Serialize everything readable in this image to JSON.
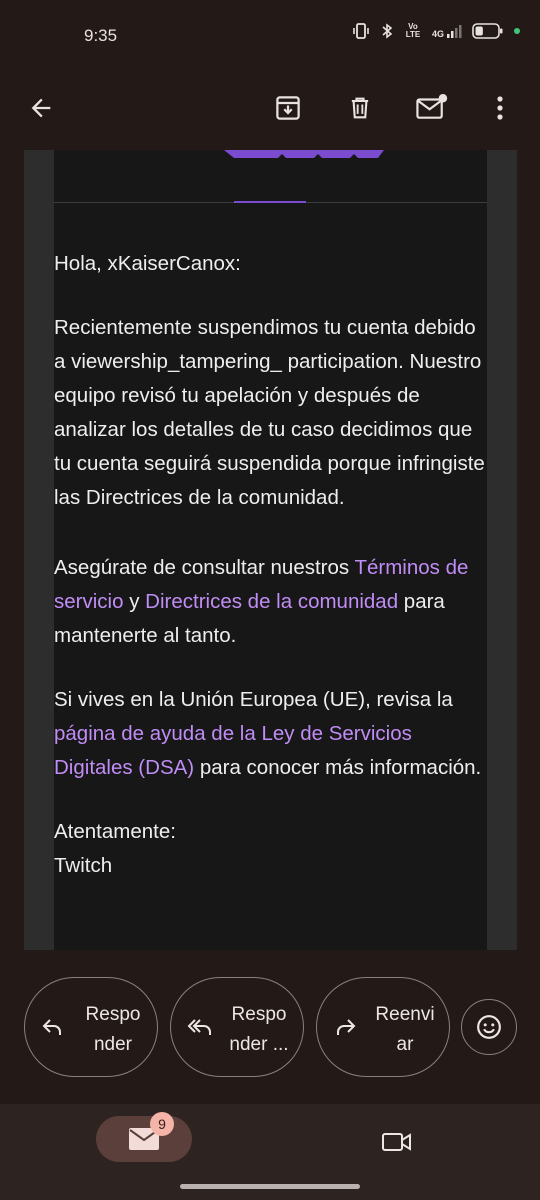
{
  "status_bar": {
    "time": "9:35",
    "network": "4G",
    "volte_label": "Vo LTE",
    "battery_level": 0.35
  },
  "toolbar": {
    "icons": [
      "back-arrow-icon",
      "archive-icon",
      "delete-icon",
      "mark-unread-icon",
      "more-vert-icon"
    ]
  },
  "email": {
    "greeting": "Hola, xKaiserCanox:",
    "paragraph1": "Recientemente suspendimos tu cuenta debido a viewership_tampering_ participation. Nuestro equipo revisó tu apelación y después de analizar los detalles de tu caso decidimos que tu cuenta seguirá suspendida porque infringiste las Directrices de la comunidad.",
    "p2_prefix": "Asegúrate de consultar nuestros ",
    "p2_link1": "Términos de servicio",
    "p2_mid": " y ",
    "p2_link2": "Directrices de la comunidad",
    "p2_suffix": " para mantenerte al tanto.",
    "p3_prefix": "Si vives en la Unión Europea (UE), revisa la ",
    "p3_link": "página de ayuda de la Ley de Servicios Digitales (DSA)",
    "p3_suffix": " para conocer más información.",
    "closing": "Atentamente:",
    "signature": "Twitch"
  },
  "actions": {
    "reply": "Respo nder",
    "reply_all": "Respo nder ...",
    "forward": "Reenvi ar"
  },
  "bottom_nav": {
    "mail_badge": "9"
  },
  "colors": {
    "background": "#231a18",
    "link": "#c08cf5",
    "accent": "#7b4bd0",
    "badge": "#f4b4a8"
  }
}
